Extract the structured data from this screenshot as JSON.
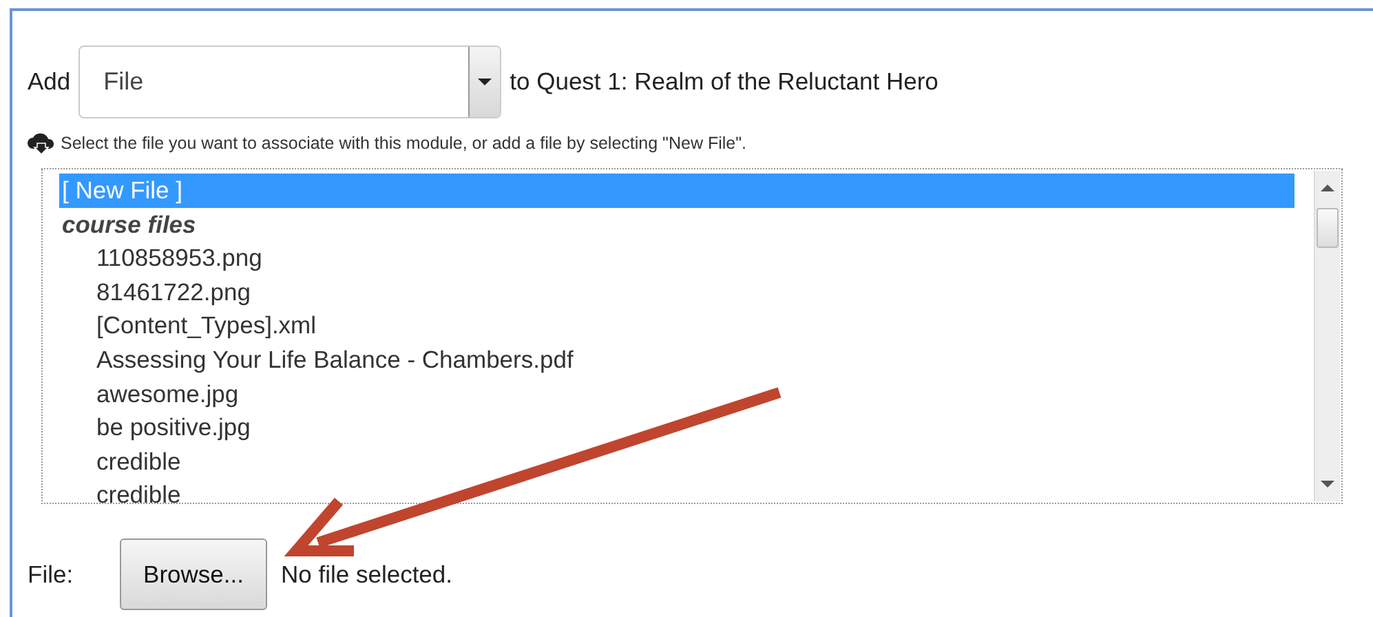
{
  "add_row": {
    "label": "Add",
    "select": {
      "value": "File"
    },
    "target": "to Quest 1: Realm of the Reluctant Hero"
  },
  "hint": "Select the file you want to associate with this module, or add a file by selecting \"New File\".",
  "file_list": {
    "items": [
      {
        "kind": "option",
        "label": "[ New File ]",
        "selected": true
      },
      {
        "kind": "group",
        "label": "course files",
        "children": [
          {
            "label": "110858953.png",
            "selected": false
          },
          {
            "label": "81461722.png",
            "selected": false
          },
          {
            "label": "[Content_Types].xml",
            "selected": false
          },
          {
            "label": "Assessing Your Life Balance - Chambers.pdf",
            "selected": false
          },
          {
            "label": "awesome.jpg",
            "selected": false
          },
          {
            "label": "be positive.jpg",
            "selected": false
          },
          {
            "label": "credible",
            "selected": false
          },
          {
            "label": "credible",
            "selected": false
          }
        ]
      }
    ]
  },
  "file_row": {
    "label": "File:",
    "button": "Browse...",
    "status": "No file selected."
  }
}
